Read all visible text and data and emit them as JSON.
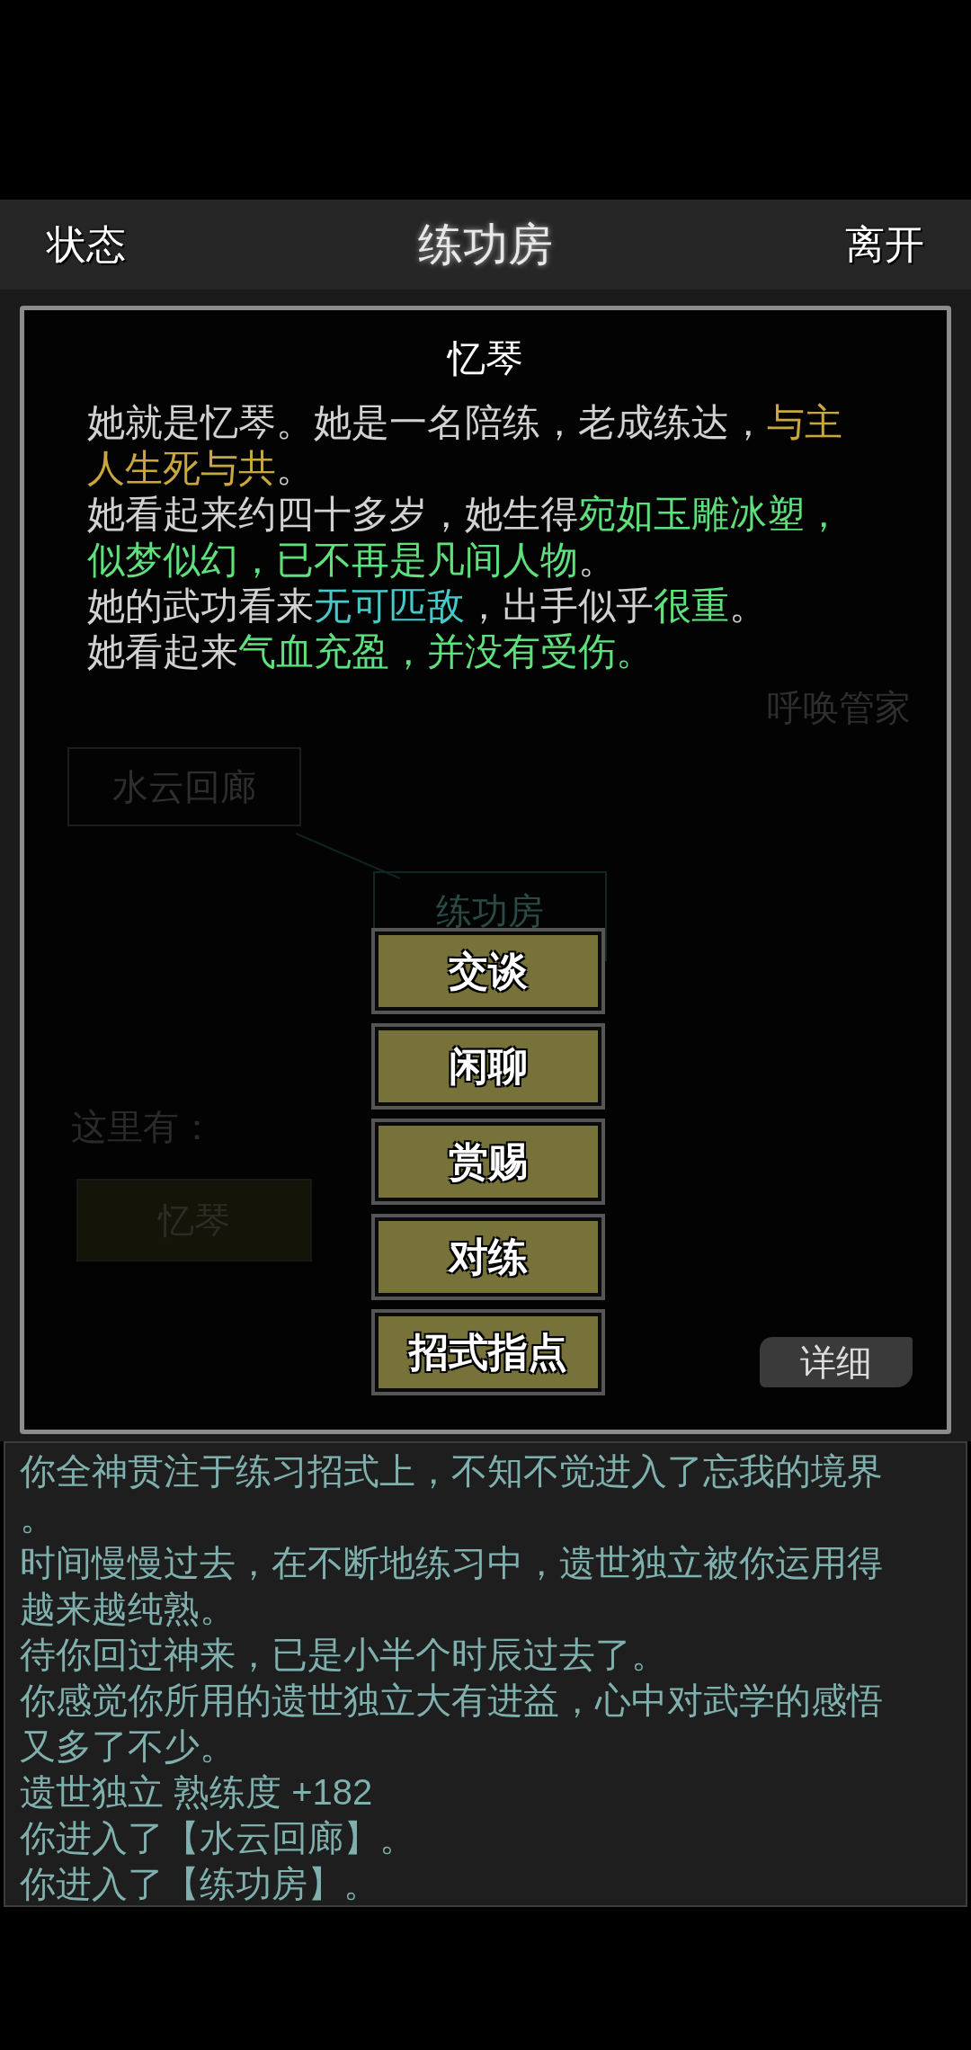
{
  "header": {
    "left": "状态",
    "title": "练功房",
    "right": "离开"
  },
  "background": {
    "call_button": "呼唤管家",
    "exits": [
      {
        "label": "水云回廊"
      },
      {
        "label": "练功房"
      }
    ],
    "here_label": "这里有：",
    "people": [
      "忆琴"
    ]
  },
  "dialog": {
    "title": "忆琴",
    "paragraphs": [
      [
        {
          "text": "她就是忆琴。她是一名陪练，老成练达，"
        },
        {
          "text": "与主人生死与共",
          "color": "#c9a640"
        },
        {
          "text": "。"
        }
      ],
      [
        {
          "text": "她看起来约四十多岁，她生得"
        },
        {
          "text": "宛如玉雕冰塑，似梦似幻，已不再是凡间人物",
          "color": "#5ee07c"
        },
        {
          "text": "。"
        }
      ],
      [
        {
          "text": "她的武功看来"
        },
        {
          "text": "无可匹敌",
          "color": "#48c8c8"
        },
        {
          "text": "，出手似乎"
        },
        {
          "text": "很重",
          "color": "#5ee07c"
        },
        {
          "text": "。"
        }
      ],
      [
        {
          "text": "她看起来"
        },
        {
          "text": "气血充盈，并没有受伤。",
          "color": "#5ee07c"
        }
      ]
    ],
    "actions": [
      "交谈",
      "闲聊",
      "赏赐",
      "对练",
      "招式指点"
    ],
    "detail_button": "详细"
  },
  "log": [
    "你全神贯注于练习招式上，不知不觉进入了忘我的境界。",
    "时间慢慢过去，在不断地练习中，遗世独立被你运用得越来越纯熟。",
    "待你回过神来，已是小半个时辰过去了。",
    "你感觉你所用的遗世独立大有进益，心中对武学的感悟又多了不少。",
    "遗世独立 熟练度 +182",
    "你进入了【水云回廊】。",
    "你进入了【练功房】。"
  ]
}
